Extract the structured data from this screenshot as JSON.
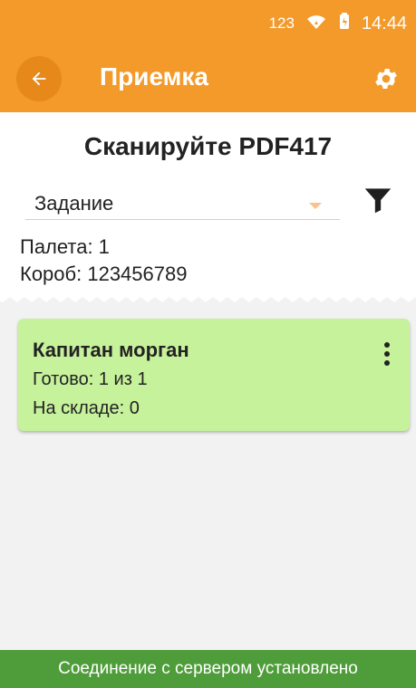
{
  "status": {
    "input_mode": "123",
    "time": "14:44"
  },
  "header": {
    "title": "Приемка"
  },
  "scan": {
    "title": "Сканируйте PDF417"
  },
  "task": {
    "label": "Задание"
  },
  "info": {
    "pallet": "Палета: 1",
    "box": "Короб: 123456789"
  },
  "card": {
    "title": "Капитан морган",
    "ready": "Готово: 1 из 1",
    "stock": "На складе: 0"
  },
  "footer": {
    "status": "Соединение с сервером установлено"
  },
  "icons": {
    "back": "arrow-left-icon",
    "settings": "gear-icon",
    "filter": "filter-icon",
    "menu": "more-vert-icon"
  },
  "colors": {
    "primary": "#f39a2b",
    "card": "#c7f29c",
    "footer": "#4f9d3a"
  }
}
